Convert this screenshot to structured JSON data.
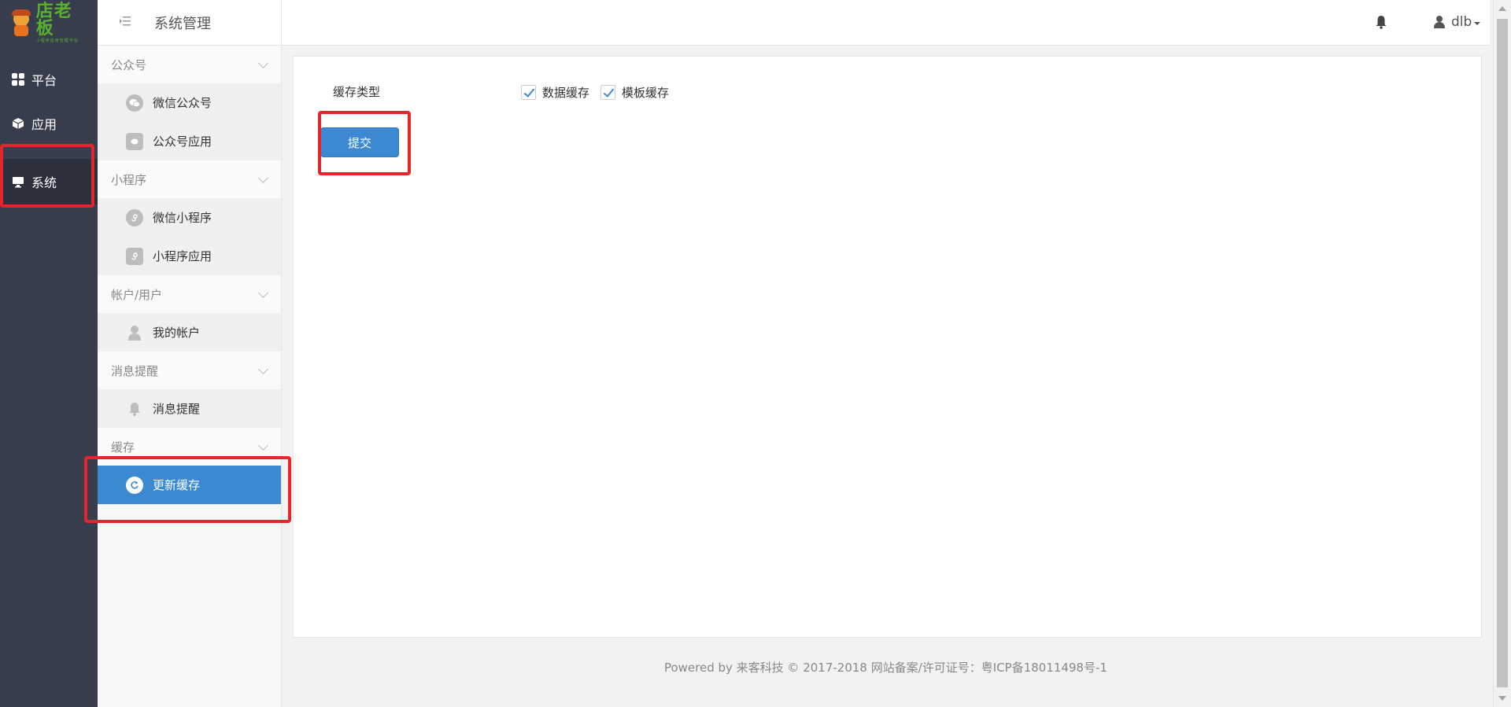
{
  "colors": {
    "rail_bg": "#383d4d",
    "accent": "#3d89d1",
    "highlight": "#e4252a"
  },
  "logo": {
    "brand_text": "店老板",
    "tagline": "小程序应用管理平台"
  },
  "rail": [
    {
      "label": "平台",
      "icon": "grid-icon"
    },
    {
      "label": "应用",
      "icon": "cube-icon"
    },
    {
      "label": "系统",
      "icon": "monitor-icon",
      "active": true
    }
  ],
  "subnav": {
    "title": "系统管理",
    "groups": [
      {
        "label": "公众号",
        "items": [
          {
            "label": "微信公众号",
            "icon": "wechat-icon"
          },
          {
            "label": "公众号应用",
            "icon": "wechat-app-icon"
          }
        ]
      },
      {
        "label": "小程序",
        "items": [
          {
            "label": "微信小程序",
            "icon": "miniprogram-icon"
          },
          {
            "label": "小程序应用",
            "icon": "miniprogram-app-icon"
          }
        ]
      },
      {
        "label": "帐户/用户",
        "items": [
          {
            "label": "我的帐户",
            "icon": "user-icon"
          }
        ]
      },
      {
        "label": "消息提醒",
        "items": [
          {
            "label": "消息提醒",
            "icon": "bell-icon"
          }
        ]
      },
      {
        "label": "缓存",
        "items": [
          {
            "label": "更新缓存",
            "icon": "refresh-icon",
            "active": true
          }
        ]
      }
    ]
  },
  "topbar": {
    "username": "dlb"
  },
  "form": {
    "field_label": "缓存类型",
    "options": [
      {
        "label": "数据缓存",
        "checked": true
      },
      {
        "label": "模板缓存",
        "checked": true
      }
    ],
    "submit_label": "提交"
  },
  "footer": "Powered by 来客科技 © 2017-2018 网站备案/许可证号：粤ICP备18011498号-1"
}
